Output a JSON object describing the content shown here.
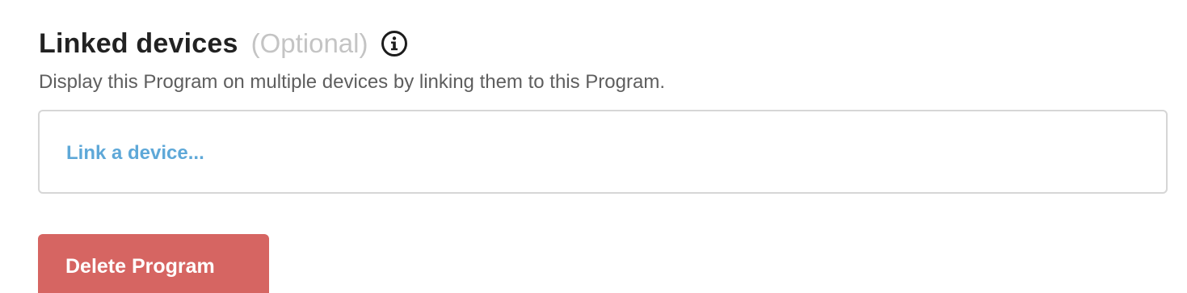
{
  "section": {
    "title": "Linked devices",
    "optional_label": "(Optional)",
    "info_icon": "info-circle-icon",
    "description": "Display this Program on multiple devices by linking them to this Program."
  },
  "link_box": {
    "link_label": "Link a device..."
  },
  "actions": {
    "delete_label": "Delete Program"
  },
  "colors": {
    "title": "#222222",
    "optional": "#c4c4c4",
    "description": "#5e5e5e",
    "link": "#5ea8d8",
    "box_border": "#d6d6d6",
    "delete_bg": "#d66562",
    "delete_text": "#ffffff"
  }
}
